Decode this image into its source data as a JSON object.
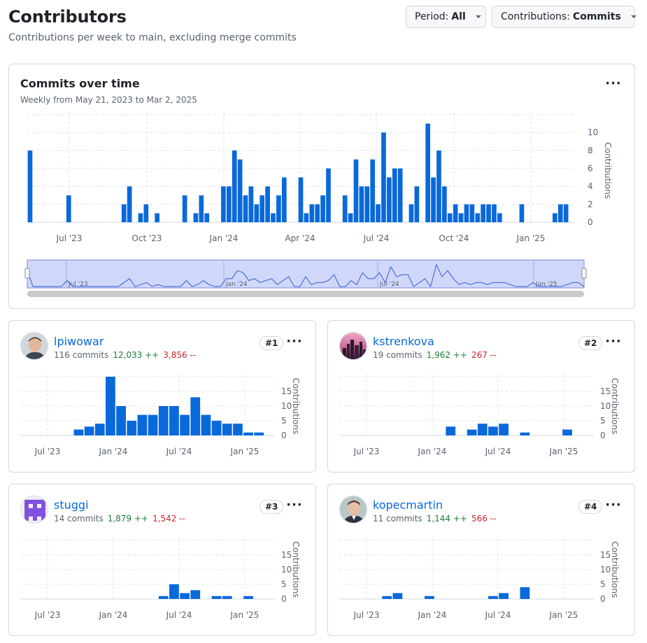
{
  "page": {
    "title": "Contributors",
    "subtitle": "Contributions per week to main, excluding merge commits"
  },
  "filters": {
    "period_label": "Period:",
    "period_value": "All",
    "contributions_label": "Contributions:",
    "contributions_value": "Commits"
  },
  "main_chart": {
    "title": "Commits over time",
    "subtitle": "Weekly from May 21, 2023 to Mar 2, 2025",
    "menu_icon": "kebab-horizontal-icon"
  },
  "colors": {
    "bar": "#0969da",
    "add": "#1a7f37",
    "del": "#d1242f",
    "link": "#0969da",
    "navigator_fill": "#d0d7fb",
    "grid": "#e1e4e8"
  },
  "chart_data": [
    {
      "type": "bar",
      "title": "Commits over time",
      "ylabel": "Contributions",
      "x_ticks": [
        "Jul '23",
        "Oct '23",
        "Jan '24",
        "Apr '24",
        "Jul '24",
        "Oct '24",
        "Jan '25"
      ],
      "navigator_ticks": [
        "Jul '23",
        "Jan '24",
        "Jul '24",
        "Jan '25"
      ],
      "y_ticks": [
        0,
        2,
        4,
        6,
        8,
        10
      ],
      "ylim": [
        0,
        12
      ],
      "grid": true,
      "values": [
        8,
        0,
        0,
        0,
        0,
        0,
        0,
        3,
        0,
        0,
        0,
        0,
        0,
        0,
        0,
        0,
        0,
        2,
        4,
        0,
        1,
        2,
        0,
        1,
        0,
        0,
        0,
        0,
        3,
        0,
        1,
        3,
        1,
        0,
        0,
        4,
        4,
        8,
        7,
        3,
        4,
        2,
        3,
        4,
        1,
        3,
        5,
        0,
        0,
        5,
        1,
        2,
        2,
        3,
        6,
        0,
        0,
        3,
        1,
        7,
        4,
        4,
        7,
        2,
        10,
        5,
        6,
        6,
        0,
        2,
        4,
        0,
        11,
        5,
        8,
        4,
        1,
        2,
        1,
        2,
        2,
        1,
        2,
        2,
        2,
        1,
        0,
        0,
        0,
        2,
        0,
        0,
        0,
        0,
        0,
        1,
        2,
        2,
        0
      ]
    },
    {
      "type": "bar",
      "title": "lpiwowar",
      "ylabel": "Contributions",
      "x_ticks": [
        "Jul '23",
        "Jan '24",
        "Jul '24",
        "Jan '25"
      ],
      "y_ticks": [
        0,
        5,
        10,
        15
      ],
      "ylim": [
        0,
        20
      ],
      "values": [
        0,
        0,
        0,
        0,
        0,
        2,
        3,
        4,
        20,
        10,
        5,
        7,
        7,
        10,
        10,
        7,
        13,
        7,
        5,
        4,
        4,
        1,
        1,
        0
      ]
    },
    {
      "type": "bar",
      "title": "kstrenkova",
      "ylabel": "Contributions",
      "x_ticks": [
        "Jul '23",
        "Jan '24",
        "Jul '24",
        "Jan '25"
      ],
      "y_ticks": [
        0,
        5,
        10,
        15
      ],
      "ylim": [
        0,
        20
      ],
      "values": [
        0,
        0,
        0,
        0,
        0,
        0,
        0,
        0,
        0,
        0,
        3,
        0,
        2,
        4,
        3,
        4,
        0,
        1,
        0,
        0,
        0,
        2,
        0,
        0
      ]
    },
    {
      "type": "bar",
      "title": "stuggi",
      "ylabel": "Contributions",
      "x_ticks": [
        "Jul '23",
        "Jan '24",
        "Jul '24",
        "Jan '25"
      ],
      "y_ticks": [
        0,
        5,
        10,
        15
      ],
      "ylim": [
        0,
        20
      ],
      "values": [
        0,
        0,
        0,
        0,
        0,
        0,
        0,
        0,
        0,
        0,
        0,
        0,
        0,
        1,
        5,
        2,
        3,
        0,
        1,
        1,
        0,
        1,
        0,
        0
      ]
    },
    {
      "type": "bar",
      "title": "kopecmartin",
      "ylabel": "Contributions",
      "x_ticks": [
        "Jul '23",
        "Jan '24",
        "Jul '24",
        "Jan '25"
      ],
      "y_ticks": [
        0,
        5,
        10,
        15
      ],
      "ylim": [
        0,
        20
      ],
      "values": [
        0,
        0,
        0,
        0,
        1,
        2,
        0,
        0,
        1,
        0,
        0,
        0,
        0,
        0,
        1,
        2,
        0,
        4,
        0,
        0,
        0,
        0,
        0,
        0
      ]
    }
  ],
  "contributors": [
    {
      "name": "lpiwowar",
      "rank": "#1",
      "commits": "116 commits",
      "additions": "12,033 ++",
      "deletions": "3,856 --",
      "avatar": "person-photo-avatar"
    },
    {
      "name": "kstrenkova",
      "rank": "#2",
      "commits": "19 commits",
      "additions": "1,962 ++",
      "deletions": "267 --",
      "avatar": "city-skyline-avatar"
    },
    {
      "name": "stuggi",
      "rank": "#3",
      "commits": "14 commits",
      "additions": "1,879 ++",
      "deletions": "1,542 --",
      "avatar": "purple-identicon-avatar"
    },
    {
      "name": "kopecmartin",
      "rank": "#4",
      "commits": "11 commits",
      "additions": "1,144 ++",
      "deletions": "566 --",
      "avatar": "person-photo-avatar"
    }
  ]
}
